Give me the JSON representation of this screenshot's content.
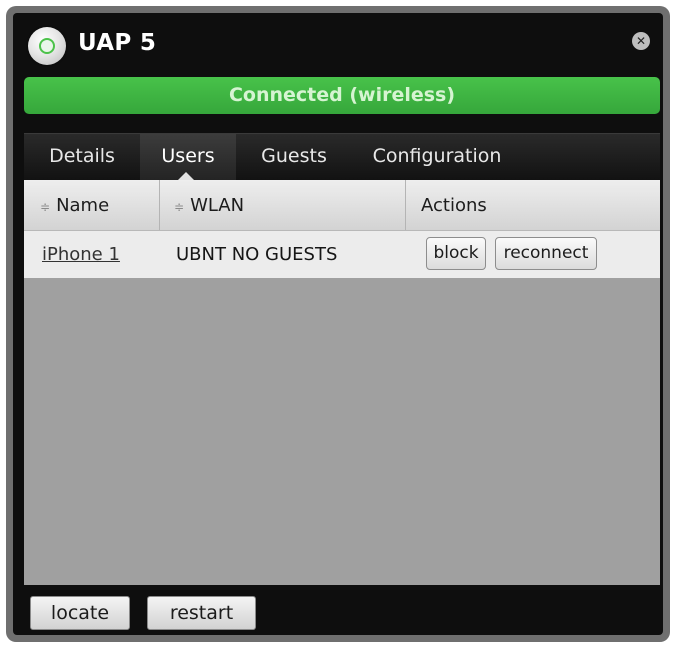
{
  "window": {
    "title": "UAP 5",
    "status": "Connected (wireless)",
    "status_color": "#3cb540",
    "close_icon": "close-icon"
  },
  "tabs": [
    {
      "label": "Details",
      "active": false
    },
    {
      "label": "Users",
      "active": true
    },
    {
      "label": "Guests",
      "active": false
    },
    {
      "label": "Configuration",
      "active": false
    }
  ],
  "table": {
    "columns": [
      "Name",
      "WLAN",
      "Actions"
    ],
    "rows": [
      {
        "name": "iPhone 1",
        "wlan": "UBNT NO GUESTS",
        "actions": [
          "block",
          "reconnect"
        ]
      }
    ]
  },
  "footer": {
    "buttons": [
      "locate",
      "restart"
    ]
  }
}
